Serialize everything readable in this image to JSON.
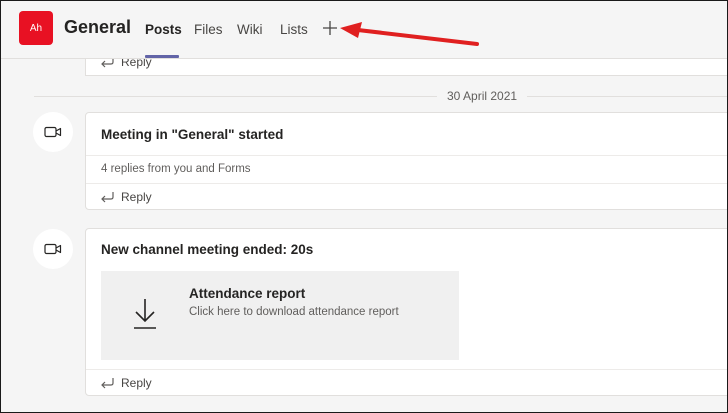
{
  "header": {
    "avatar_initials": "Ah",
    "channel_name": "General",
    "tabs": [
      {
        "label": "Posts",
        "active": true
      },
      {
        "label": "Files",
        "active": false
      },
      {
        "label": "Wiki",
        "active": false
      },
      {
        "label": "Lists",
        "active": false
      }
    ],
    "add_tab_icon": "plus-icon"
  },
  "annotation": {
    "icon": "red-arrow",
    "color": "#e02020"
  },
  "feed": {
    "partial_reply_label": "Reply",
    "date_separator": "30 April 2021",
    "posts": [
      {
        "icon": "video-camera-icon",
        "title": "Meeting in \"General\" started",
        "replies_summary": "4 replies from you and Forms",
        "reply_label": "Reply"
      },
      {
        "icon": "video-camera-icon",
        "title": "New channel meeting ended: 20s",
        "attachment": {
          "icon": "download-icon",
          "title": "Attendance report",
          "subtitle": "Click here to download attendance report"
        },
        "reply_label": "Reply"
      }
    ]
  },
  "colors": {
    "avatar": "#e81123",
    "tab_underline": "#6264a7",
    "background": "#f5f5f5",
    "card": "#ffffff"
  }
}
